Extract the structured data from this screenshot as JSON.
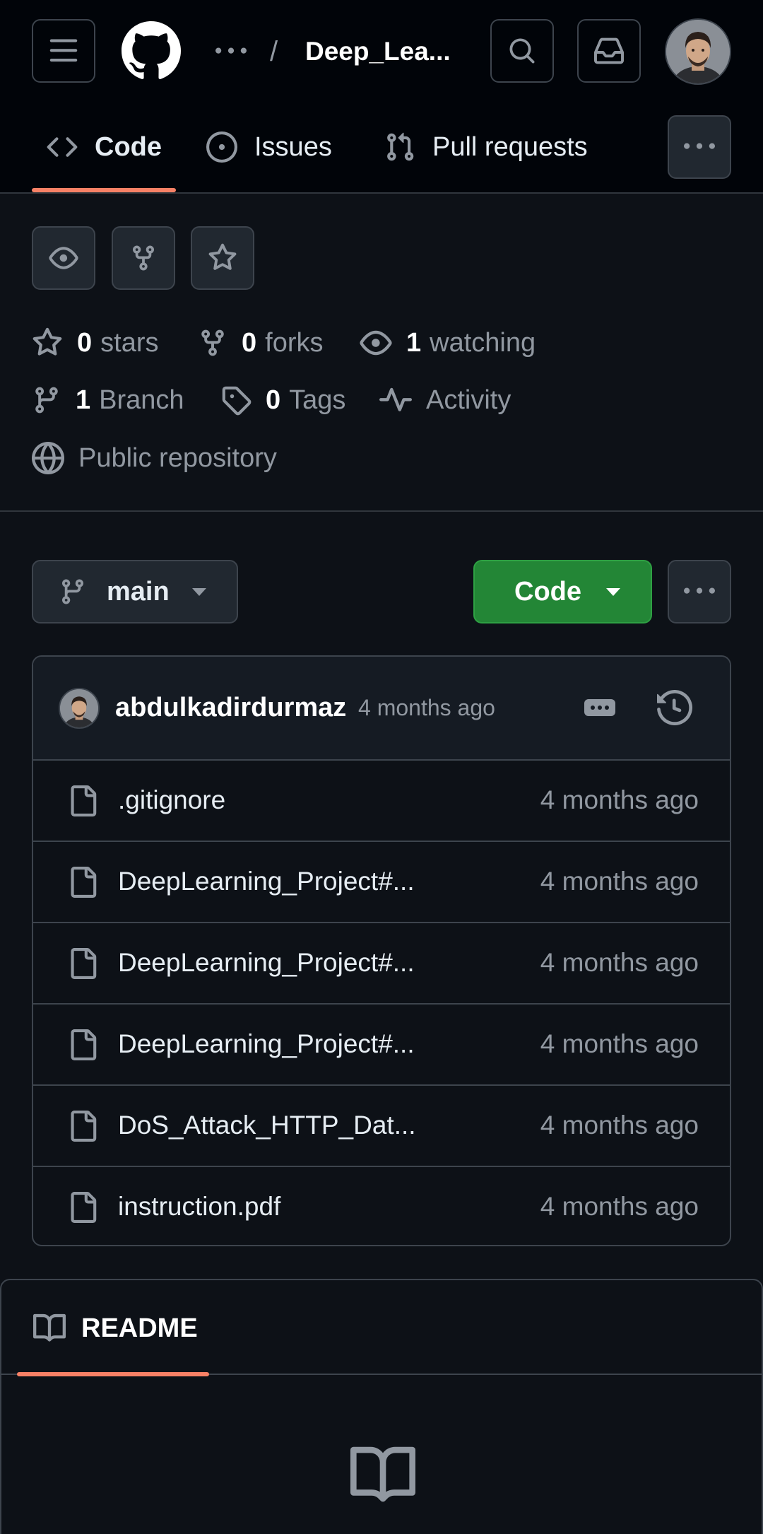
{
  "header": {
    "repo_name": "Deep_Lea...",
    "crumb_separator": "/",
    "avatar_alt": "user avatar"
  },
  "tabs": [
    {
      "label": "Code",
      "icon": "code-icon",
      "selected": true
    },
    {
      "label": "Issues",
      "icon": "issue-opened-icon"
    },
    {
      "label": "Pull requests",
      "icon": "git-pull-request-icon"
    }
  ],
  "stats": {
    "stars_count": "0",
    "stars_label": "stars",
    "forks_count": "0",
    "forks_label": "forks",
    "watching_count": "1",
    "watching_label": "watching",
    "branch_count": "1",
    "branch_label": "Branch",
    "tags_count": "0",
    "tags_label": "Tags",
    "activity_label": "Activity",
    "visibility_label": "Public repository"
  },
  "branch": {
    "name": "main",
    "code_button_label": "Code"
  },
  "latest_commit": {
    "author": "abdulkadirdurmaz",
    "time": "4 months ago"
  },
  "files": [
    {
      "name": ".gitignore",
      "time": "4 months ago",
      "icon": "file-icon"
    },
    {
      "name": "DeepLearning_Project#...",
      "time": "4 months ago",
      "icon": "file-icon"
    },
    {
      "name": "DeepLearning_Project#...",
      "time": "4 months ago",
      "icon": "file-icon"
    },
    {
      "name": "DeepLearning_Project#...",
      "time": "4 months ago",
      "icon": "file-icon"
    },
    {
      "name": "DoS_Attack_HTTP_Dat...",
      "time": "4 months ago",
      "icon": "file-icon"
    },
    {
      "name": "instruction.pdf",
      "time": "4 months ago",
      "icon": "file-icon"
    }
  ],
  "readme": {
    "tab_label": "README"
  },
  "colors": {
    "background": "#0d1117",
    "header_background": "#010409",
    "accent_underline": "#f78166",
    "primary_button": "#238636",
    "muted_text": "#9198a1",
    "border": "#3d444d"
  }
}
